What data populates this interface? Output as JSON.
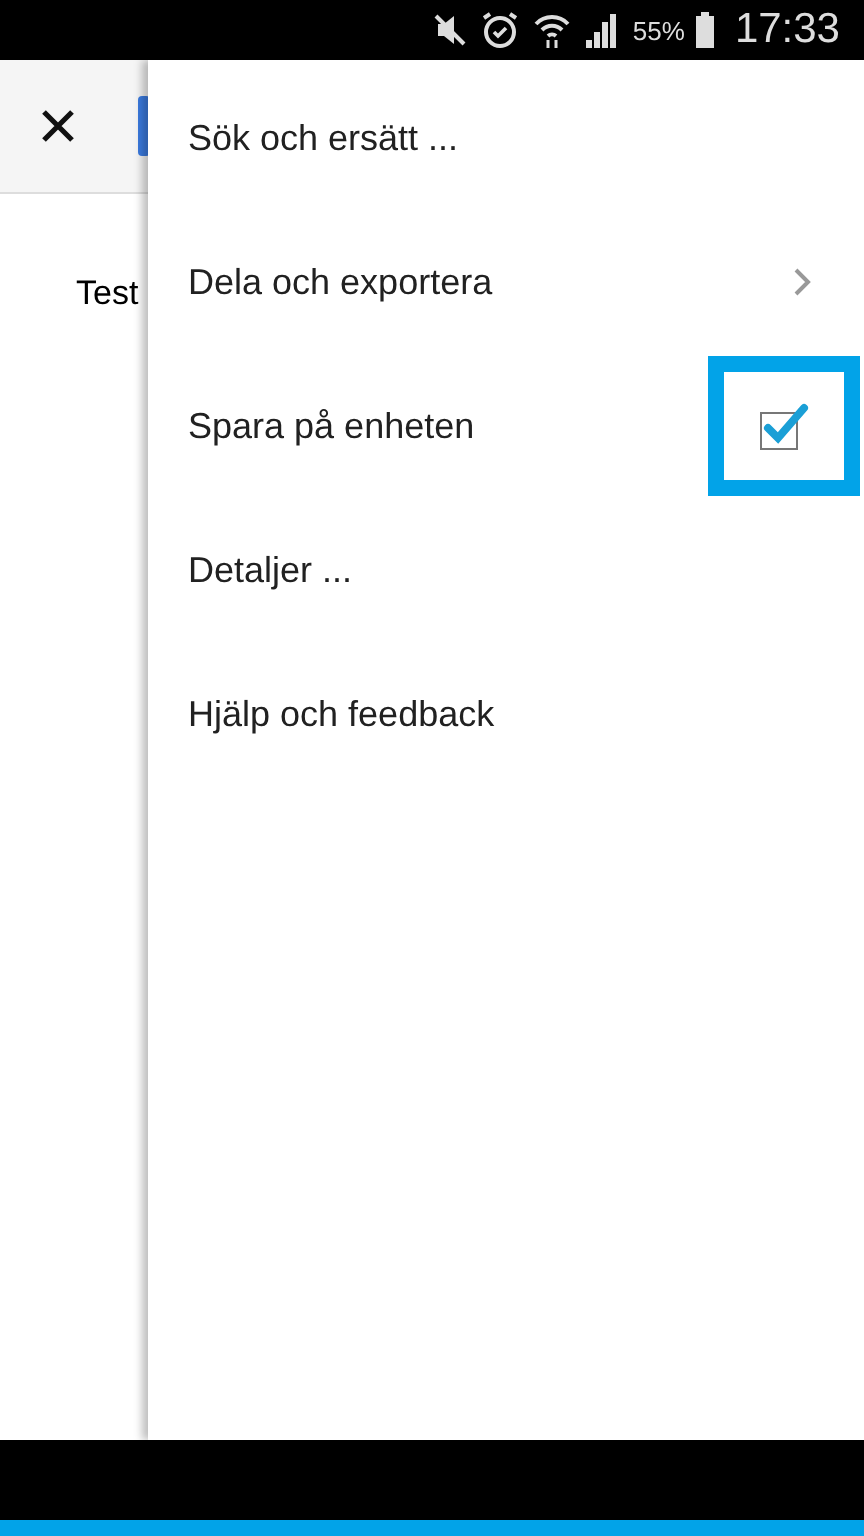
{
  "status_bar": {
    "battery": "55%",
    "time": "17:33"
  },
  "document": {
    "text": "Test"
  },
  "menu": {
    "items": [
      {
        "kind": "plain",
        "label": "Sök och ersätt ..."
      },
      {
        "kind": "submenu",
        "label": "Dela och exportera"
      },
      {
        "kind": "checkbox",
        "label": "Spara på enheten",
        "checked": true,
        "highlighted": true
      },
      {
        "kind": "plain",
        "label": "Detaljer ..."
      },
      {
        "kind": "plain",
        "label": "Hjälp och feedback"
      }
    ]
  }
}
